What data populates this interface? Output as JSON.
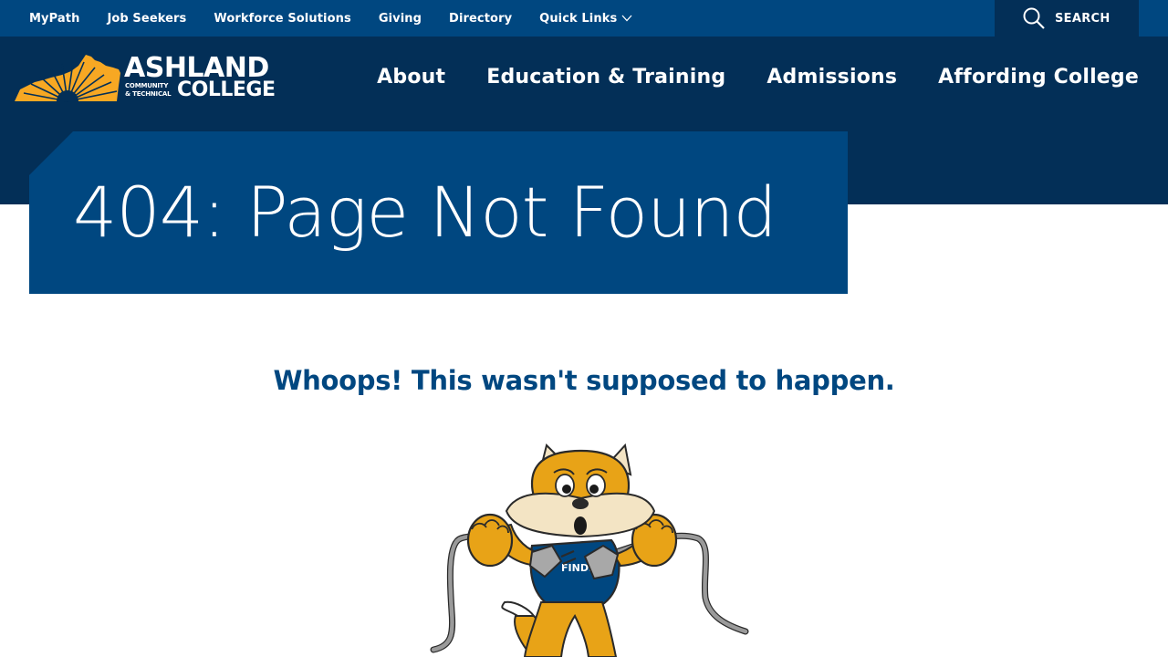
{
  "utility_nav": {
    "links": [
      "MyPath",
      "Job Seekers",
      "Workforce Solutions",
      "Giving",
      "Directory",
      "Quick Links"
    ],
    "search_label": "SEARCH"
  },
  "logo": {
    "name": "ASHLAND",
    "tagline_line1": "COMMUNITY",
    "tagline_line2": "& TECHNICAL",
    "college": "COLLEGE"
  },
  "main_nav": {
    "items": [
      "About",
      "Education & Training",
      "Admissions",
      "Affording College"
    ]
  },
  "page": {
    "title": "404: Page Not Found",
    "subheading": "Whoops! This wasn't supposed to happen."
  },
  "mascot": {
    "icon": "fox-mascot-holding-unplugged-cord",
    "shirt_text": "FINDS"
  },
  "colors": {
    "primary_blue": "#004780",
    "dark_navy": "#032f57",
    "accent_gold": "#f7a823",
    "white": "#ffffff"
  }
}
